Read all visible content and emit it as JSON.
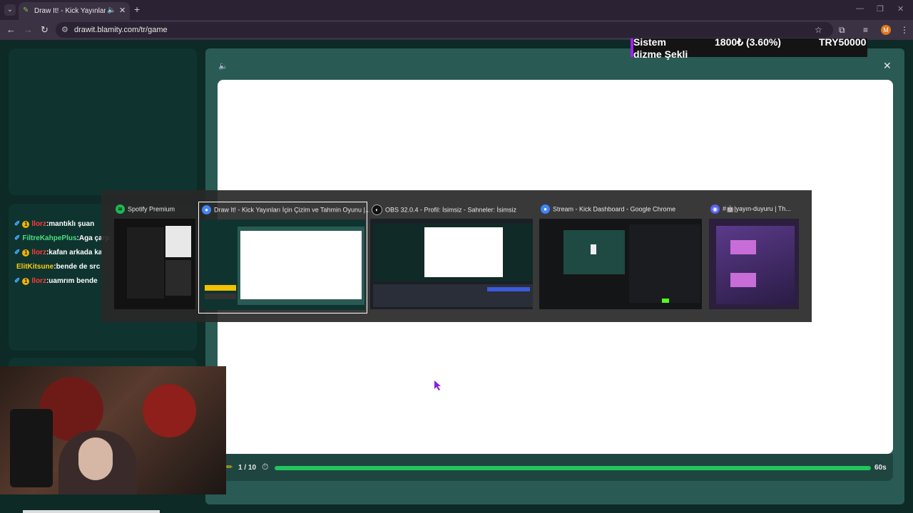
{
  "browser": {
    "tab_title": "Draw It! - Kick Yayınları İçin",
    "url": "drawit.blamity.com/tr/game",
    "avatar_letter": "M"
  },
  "chat": [
    {
      "user": "llorz",
      "msg": ":mantıklı şuan",
      "color": "#ff3b3b",
      "pin": true,
      "badge": true
    },
    {
      "user": "FiltreKahpePlus",
      "msg": ":Aga çarp",
      "color": "#4ade80",
      "pin": true,
      "badge": false
    },
    {
      "user": "llorz",
      "msg": ":kafan arkada ka",
      "color": "#ff3b3b",
      "pin": true,
      "badge": true
    },
    {
      "user": "ElitKitsune",
      "msg": ":bende de src",
      "color": "#facc15",
      "pin": false,
      "badge": false
    },
    {
      "user": "llorz",
      "msg": ":uamrım bende",
      "color": "#ff3b3b",
      "pin": true,
      "badge": true
    }
  ],
  "game": {
    "round": "1 / 10",
    "seconds": "60s",
    "progress": 1.0
  },
  "overlay": {
    "name": "Sistem dizme Şekli",
    "amount": "1800₺ (3.60%)",
    "goal": "TRY50000"
  },
  "switcher": [
    {
      "title": "Spotify Premium",
      "icon": "spotify-icon",
      "color": "#1db954",
      "selected": false
    },
    {
      "title": "Draw It! - Kick Yayınları İçin Çizim ve Tahmin Oyunu |...",
      "icon": "chrome-icon",
      "color": "#4285f4",
      "selected": true
    },
    {
      "title": "OBS 32.0.4 - Profil: İsimsiz - Sahneler: İsimsiz",
      "icon": "obs-icon",
      "color": "#222222",
      "selected": false
    },
    {
      "title": "Stream - Kick Dashboard - Google Chrome",
      "icon": "chrome-icon",
      "color": "#4285f4",
      "selected": false
    },
    {
      "title": "#🤖|yayın-duyuru | Th...",
      "icon": "discord-icon",
      "color": "#5865f2",
      "selected": false
    }
  ]
}
